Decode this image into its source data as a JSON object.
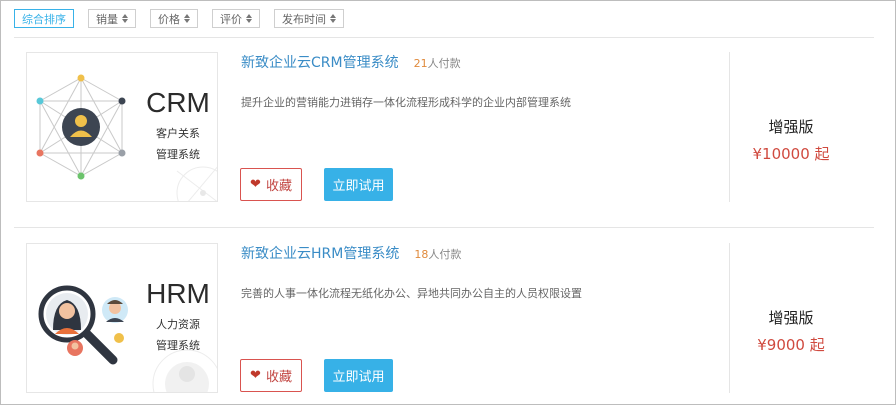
{
  "sort_bar": {
    "options": [
      {
        "label": "综合排序",
        "active": true,
        "has_arrows": false
      },
      {
        "label": "销量",
        "active": false,
        "has_arrows": true
      },
      {
        "label": "价格",
        "active": false,
        "has_arrows": true
      },
      {
        "label": "评价",
        "active": false,
        "has_arrows": true
      },
      {
        "label": "发布时间",
        "active": false,
        "has_arrows": true
      }
    ]
  },
  "products": [
    {
      "title": "新致企业云CRM管理系统",
      "paid_count": "21",
      "paid_suffix": "人付款",
      "description": "提升企业的营销能力进销存一体化流程形成科学的企业内部管理系统",
      "thumb": {
        "abbr": "CRM",
        "line1": "客户关系",
        "line2": "管理系统",
        "icon": "crm-network-icon"
      },
      "favorite_label": "收藏",
      "favorite_icon": "heart-icon",
      "try_label": "立即试用",
      "edition": "增强版",
      "price": "¥10000 起"
    },
    {
      "title": "新致企业云HRM管理系统",
      "paid_count": "18",
      "paid_suffix": "人付款",
      "description": "完善的人事一体化流程无纸化办公、异地共同办公自主的人员权限设置",
      "thumb": {
        "abbr": "HRM",
        "line1": "人力资源",
        "line2": "管理系统",
        "icon": "hrm-magnifier-icon"
      },
      "favorite_label": "收藏",
      "favorite_icon": "heart-icon",
      "try_label": "立即试用",
      "edition": "增强版",
      "price": "¥9000 起"
    }
  ],
  "colors": {
    "accent": "#38b2e8",
    "title": "#3a8cc6",
    "price": "#d04a3f",
    "favorite": "#d9534f",
    "paid_count": "#e08a3c"
  }
}
